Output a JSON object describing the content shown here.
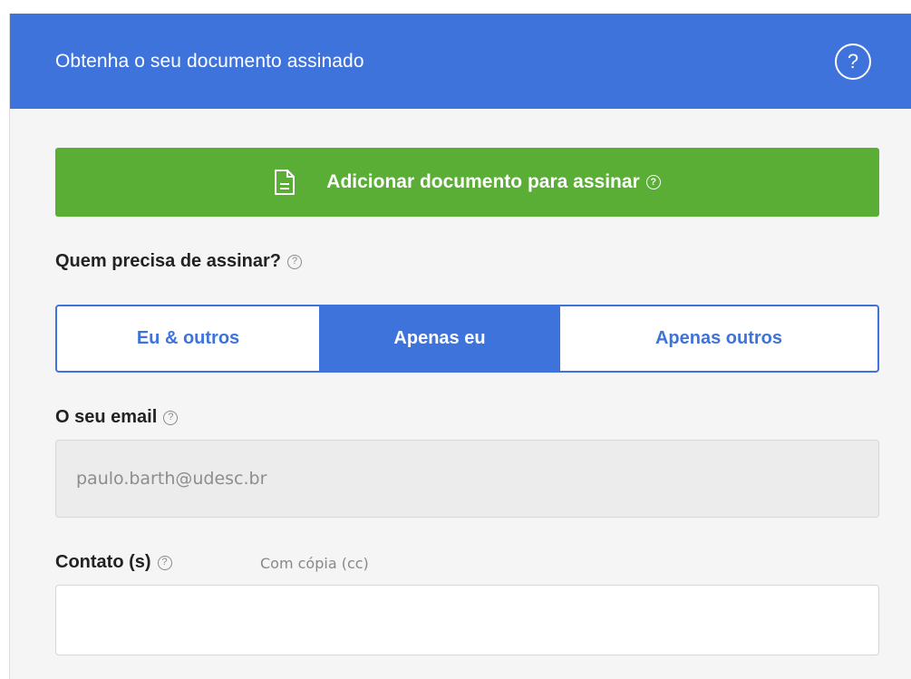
{
  "header": {
    "title": "Obtenha o seu documento assinado",
    "help_icon": "?"
  },
  "add_document": {
    "label": "Adicionar documento para assinar",
    "help": "?"
  },
  "signers": {
    "label": "Quem precisa de assinar?",
    "help": "?",
    "options": [
      "Eu & outros",
      "Apenas eu",
      "Apenas outros"
    ],
    "selected": "Apenas eu"
  },
  "email": {
    "label": "O seu email",
    "help": "?",
    "value": "paulo.barth@udesc.br"
  },
  "contacts": {
    "label": "Contato (s)",
    "help": "?",
    "cc_hint": "Com cópia (cc)",
    "value": ""
  },
  "colors": {
    "header_bg": "#3e73dc",
    "primary_blue": "#3e73dc",
    "add_button_green": "#5aae35",
    "panel_bg": "#f5f5f5"
  },
  "icons": {
    "help": "question-circle-icon",
    "document": "document-icon"
  }
}
